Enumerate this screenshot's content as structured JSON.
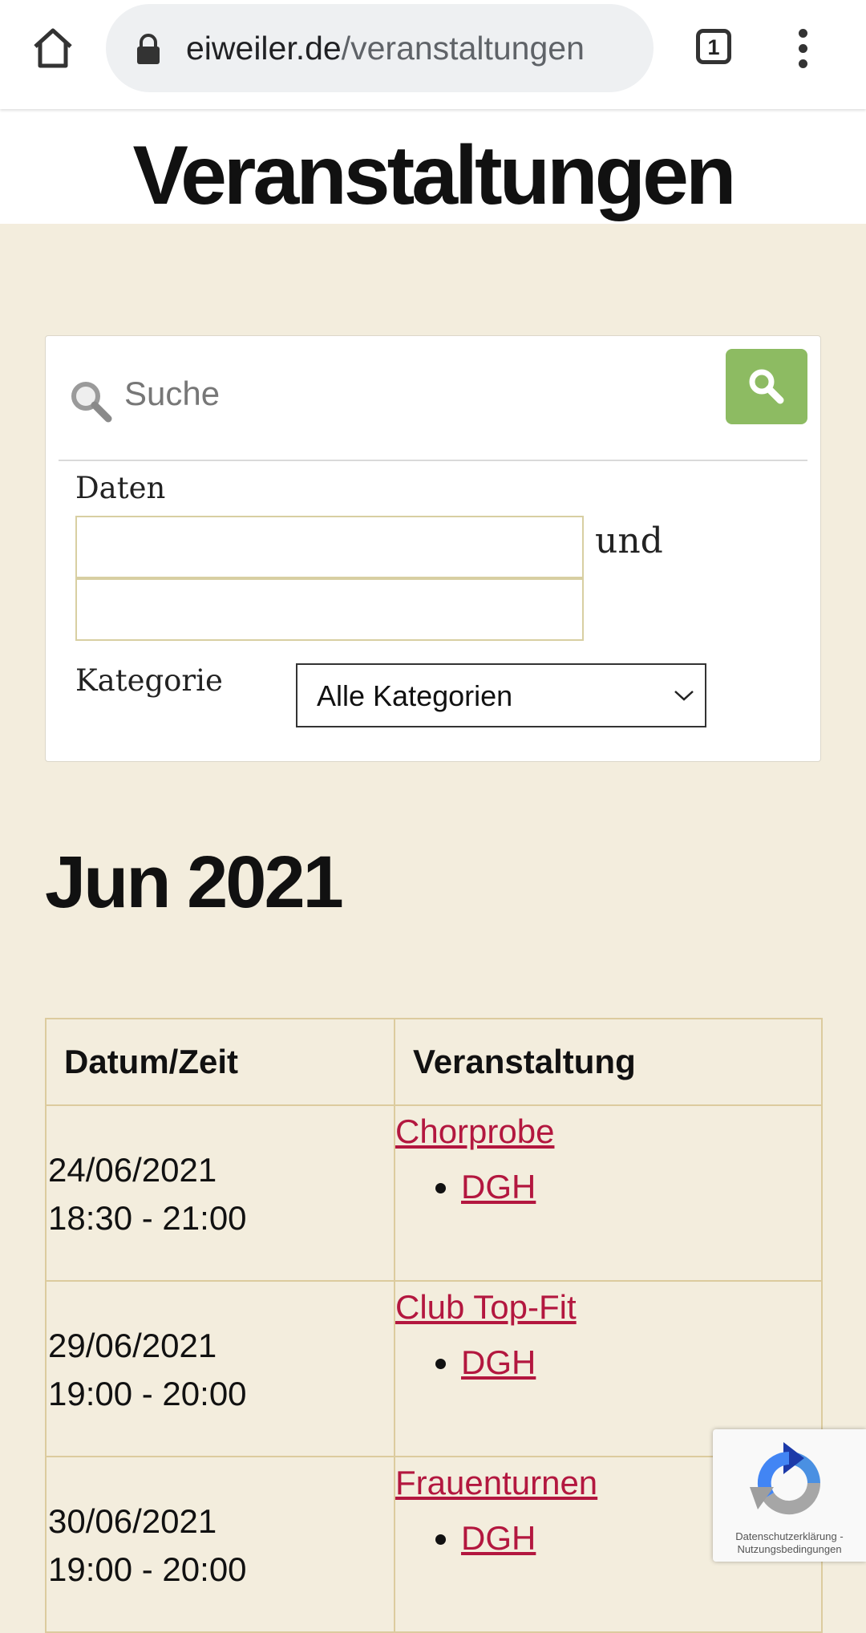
{
  "browser": {
    "url_domain": "eiweiler.de",
    "url_path": "/veranstaltungen",
    "tab_count": "1"
  },
  "page": {
    "title": "Veranstaltungen"
  },
  "search_form": {
    "search_placeholder": "Suche",
    "dates_label": "Daten",
    "dates_connector": "und",
    "category_label": "Kategorie",
    "category_selected": "Alle Kategorien"
  },
  "month_heading": "Jun 2021",
  "events_table": {
    "headers": [
      "Datum/Zeit",
      "Veranstaltung"
    ],
    "rows": [
      {
        "date": "24/06/2021",
        "time": "18:30 - 21:00",
        "title": "Chorprobe",
        "location": "DGH"
      },
      {
        "date": "29/06/2021",
        "time": "19:00 - 20:00",
        "title": "Club Top-Fit",
        "location": "DGH"
      },
      {
        "date": "30/06/2021",
        "time": "19:00 - 20:00",
        "title": "Frauenturnen",
        "location": "DGH"
      }
    ]
  },
  "recaptcha": {
    "privacy": "Datenschutzerklärung",
    "separator": "-",
    "terms": "Nutzungsbedingungen"
  },
  "colors": {
    "background": "#f3eddd",
    "link": "#b3173f",
    "search_button": "#8dbb62",
    "table_border": "#dccb9e"
  },
  "icons": [
    "home-icon",
    "lock-icon",
    "tabs-icon",
    "more-vert-icon",
    "search-icon",
    "chevron-down-icon",
    "recaptcha-logo"
  ]
}
